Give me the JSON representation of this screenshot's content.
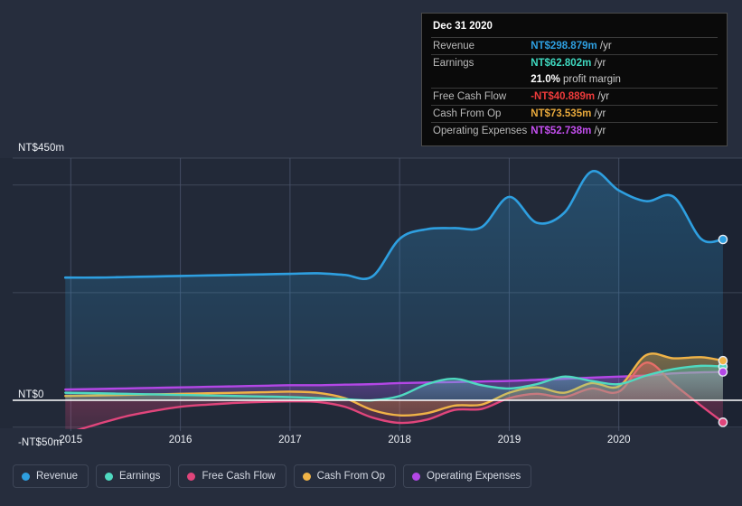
{
  "axis": {
    "y_labels": [
      {
        "text": "NT$450m",
        "value": 450
      },
      {
        "text": "NT$0",
        "value": 0
      },
      {
        "text": "-NT$50m",
        "value": -50
      }
    ],
    "x_labels": [
      "2015",
      "2016",
      "2017",
      "2018",
      "2019",
      "2020"
    ]
  },
  "tooltip": {
    "date": "Dec 31 2020",
    "rows": [
      {
        "label": "Revenue",
        "value": "NT$298.879m",
        "unit": "/yr",
        "color": "#2e9fe0"
      },
      {
        "label": "Earnings",
        "value": "NT$62.802m",
        "unit": "/yr",
        "color": "#3fd9c0"
      },
      {
        "label": "Free Cash Flow",
        "value": "-NT$40.889m",
        "unit": "/yr",
        "color": "#ee3b3b"
      },
      {
        "label": "Cash From Op",
        "value": "NT$73.535m",
        "unit": "/yr",
        "color": "#e8a93c"
      },
      {
        "label": "Operating Expenses",
        "value": "NT$52.738m",
        "unit": "/yr",
        "color": "#c44ff0"
      }
    ],
    "margin_value": "21.0%",
    "margin_label": "profit margin"
  },
  "legend": [
    {
      "label": "Revenue",
      "color": "#2e9fe0"
    },
    {
      "label": "Earnings",
      "color": "#4fd9c0"
    },
    {
      "label": "Free Cash Flow",
      "color": "#e0457b"
    },
    {
      "label": "Cash From Op",
      "color": "#f0b347"
    },
    {
      "label": "Operating Expenses",
      "color": "#b347e6"
    }
  ],
  "chart_data": {
    "type": "area",
    "title": "",
    "xlabel": "",
    "ylabel": "NT$",
    "currency": "NT$",
    "units": "millions per year",
    "grid": true,
    "legend_position": "bottom",
    "xlim": [
      2014.75,
      2021.0
    ],
    "ylim": [
      -65,
      470
    ],
    "yticks": [
      450,
      400,
      200,
      0,
      -50
    ],
    "ytick_labels_shown": [
      "NT$450m",
      "NT$0",
      "-NT$50m"
    ],
    "xticks": [
      2015,
      2016,
      2017,
      2018,
      2019,
      2020
    ],
    "highlight_region": {
      "from": 2020.0,
      "to": 2021.0,
      "note": "latest reported period shading"
    },
    "zero_line": 0,
    "x": [
      2014.95,
      2015.25,
      2015.5,
      2015.75,
      2016.0,
      2016.25,
      2016.5,
      2016.75,
      2017.0,
      2017.25,
      2017.5,
      2017.75,
      2018.0,
      2018.25,
      2018.5,
      2018.75,
      2019.0,
      2019.25,
      2019.5,
      2019.75,
      2020.0,
      2020.25,
      2020.5,
      2020.75,
      2020.95
    ],
    "series": [
      {
        "name": "Revenue",
        "color": "#2e9fe0",
        "end_value": 298.879,
        "values": [
          228,
          228,
          229,
          230,
          231,
          232,
          233,
          234,
          235,
          236,
          233,
          230,
          300,
          318,
          320,
          322,
          378,
          330,
          348,
          425,
          390,
          370,
          378,
          300,
          298.879
        ]
      },
      {
        "name": "Earnings",
        "color": "#4fd9c0",
        "end_value": 62.802,
        "values": [
          14,
          13,
          12,
          11,
          10,
          9,
          8,
          7,
          6,
          4,
          2,
          0,
          8,
          30,
          40,
          28,
          22,
          30,
          44,
          36,
          30,
          46,
          58,
          64,
          62.802
        ]
      },
      {
        "name": "Free Cash Flow",
        "color": "#e0457b",
        "end_value": -40.889,
        "values": [
          -62,
          -44,
          -30,
          -20,
          -12,
          -8,
          -5,
          -3,
          -2,
          -3,
          -12,
          -32,
          -42,
          -36,
          -18,
          -16,
          4,
          12,
          6,
          22,
          16,
          70,
          30,
          -10,
          -40.889
        ]
      },
      {
        "name": "Cash From Op",
        "color": "#f0b347",
        "end_value": 73.535,
        "values": [
          8,
          9,
          10,
          11,
          12,
          13,
          14,
          15,
          16,
          14,
          4,
          -18,
          -28,
          -24,
          -10,
          -8,
          14,
          24,
          14,
          32,
          26,
          84,
          78,
          80,
          73.535
        ]
      },
      {
        "name": "Operating Expenses",
        "color": "#b347e6",
        "end_value": 52.738,
        "values": [
          20,
          21,
          22,
          23,
          24,
          25,
          26,
          27,
          28,
          28,
          29,
          30,
          32,
          33,
          34,
          35,
          36,
          38,
          40,
          42,
          44,
          46,
          50,
          52,
          52.738
        ]
      }
    ]
  }
}
